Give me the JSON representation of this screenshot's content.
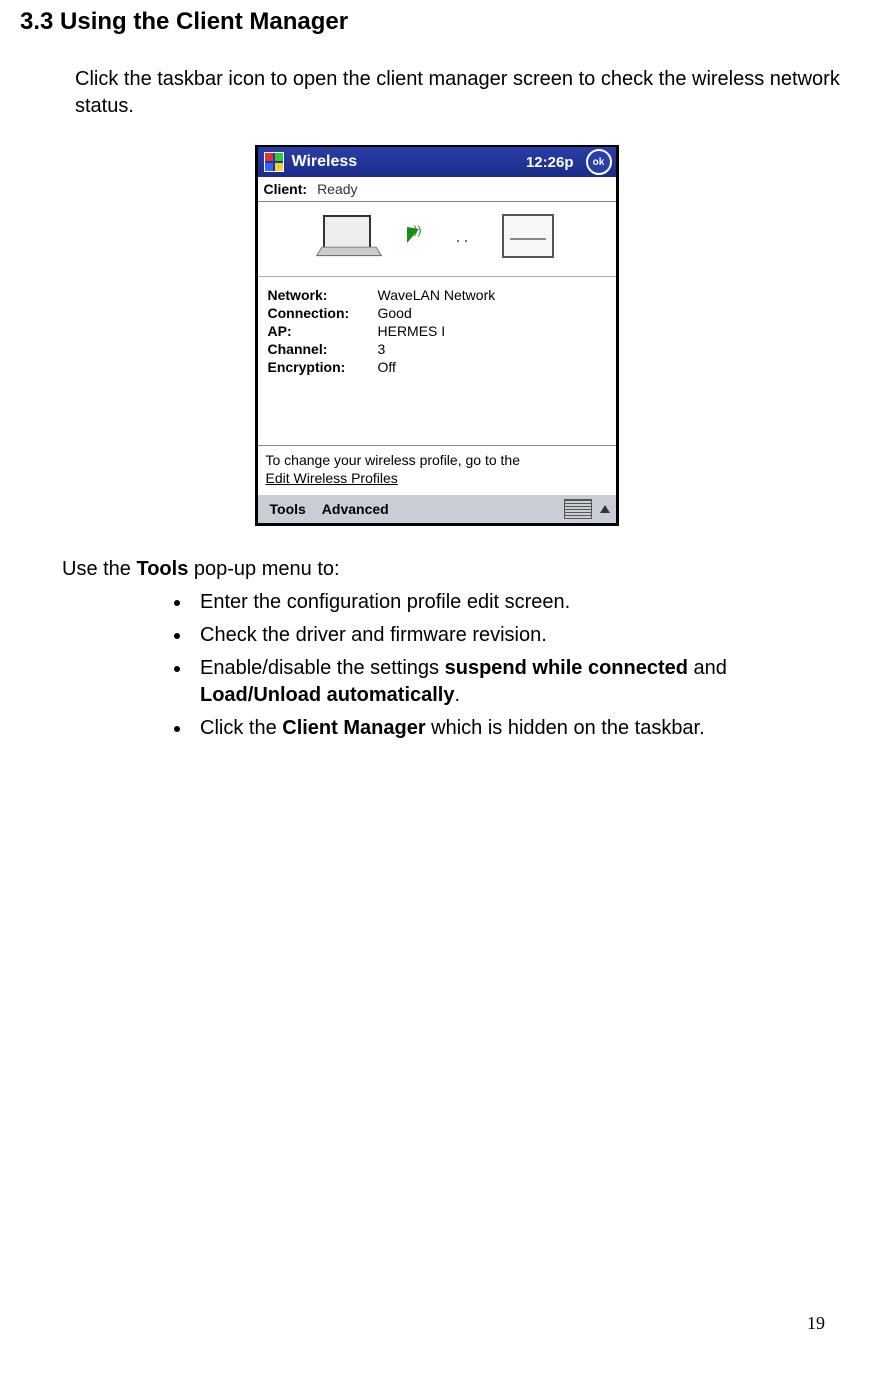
{
  "section": {
    "heading": "3.3 Using the Client Manager",
    "intro": "Click the taskbar icon to open the client manager screen to check the wireless network status."
  },
  "screenshot": {
    "titlebar": {
      "title": "Wireless",
      "clock": "12:26p",
      "ok": "ok"
    },
    "client": {
      "label": "Client:",
      "value": "Ready"
    },
    "dots": "..",
    "info": {
      "network_k": "Network:",
      "network_v": "WaveLAN Network",
      "connection_k": "Connection:",
      "connection_v": "Good",
      "ap_k": "AP:",
      "ap_v": "HERMES I",
      "channel_k": "Channel:",
      "channel_v": "3",
      "encryption_k": "Encryption:",
      "encryption_v": "Off"
    },
    "hint": {
      "text": "To change your wireless profile, go to the",
      "link": "Edit Wireless Profiles"
    },
    "menu": {
      "tools": "Tools",
      "advanced": "Advanced"
    }
  },
  "post": {
    "tools_pre": "Use the ",
    "tools_bold": "Tools",
    "tools_post": " pop-up menu to:",
    "bullets": {
      "b1": "Enter the configuration profile edit screen.",
      "b2": "Check the driver and firmware revision.",
      "b3_pre": "Enable/disable the settings ",
      "b3_b1": "suspend while connected",
      "b3_mid": " and ",
      "b3_b2": "Load/Unload automatically",
      "b3_post": ".",
      "b4_pre": "Click the ",
      "b4_b": "Client Manager",
      "b4_post": "  which is hidden on the taskbar."
    }
  },
  "page_number": "19"
}
